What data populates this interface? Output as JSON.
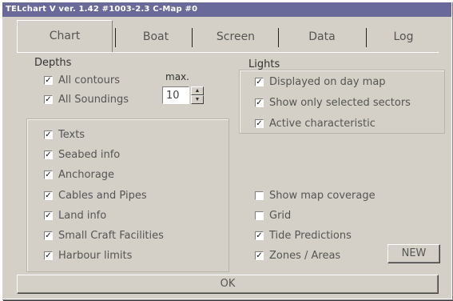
{
  "window": {
    "title": "TELchart V ver. 1.42  #1003-2.3  C-Map #0"
  },
  "tabs": [
    {
      "label": "Chart"
    },
    {
      "label": "Boat"
    },
    {
      "label": "Screen"
    },
    {
      "label": "Data"
    },
    {
      "label": "Log"
    }
  ],
  "depths": {
    "heading": "Depths",
    "all_contours": "All contours",
    "all_soundings": "All Soundings",
    "max_label": "max.",
    "max_value": "10"
  },
  "lights": {
    "heading": "Lights",
    "items": [
      "Displayed on day map",
      "Show only selected sectors",
      "Active characteristic"
    ]
  },
  "options_left": [
    "Texts",
    "Seabed info",
    "Anchorage",
    "Cables and Pipes",
    "Land info",
    "Small Craft Facilities",
    "Harbour limits"
  ],
  "options_right": [
    {
      "label": "Show map coverage",
      "checked": false
    },
    {
      "label": "Grid",
      "checked": false
    },
    {
      "label": "Tide Predictions",
      "checked": true
    },
    {
      "label": "Zones / Areas",
      "checked": true
    }
  ],
  "buttons": {
    "new_label": "NEW",
    "ok_label": "OK"
  }
}
